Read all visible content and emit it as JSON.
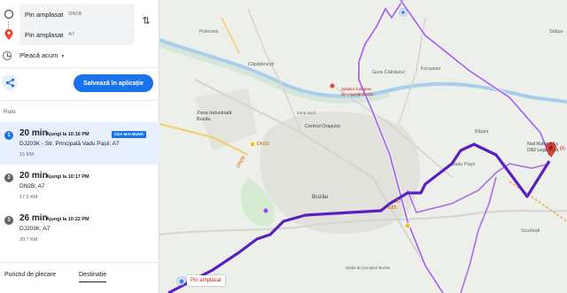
{
  "waypoints": [
    {
      "main": "Pin amplasat",
      "sub": "DN1B"
    },
    {
      "main": "Pin amplasat",
      "sub": "A7"
    }
  ],
  "depart": {
    "label": "Pleacă acum"
  },
  "save_button": {
    "label": "Salvează în aplicație"
  },
  "routes": {
    "title": "Rute",
    "items": [
      {
        "index": "1",
        "time": "20 min",
        "arrive": "Ajungi la 10:16 PM",
        "badge": "CEA MAI BUNĂ",
        "via": "DJ203K - Str. Principală Vadu Pașii; A7",
        "distance": "15 KM"
      },
      {
        "index": "2",
        "time": "20 min",
        "arrive": "Ajungi la 10:17 PM",
        "via": "DN2B; A7",
        "distance": "17.2 KM"
      },
      {
        "index": "3",
        "time": "26 min",
        "arrive": "Ajungi la 10:22 PM",
        "via": "DJ203K; A7",
        "distance": "20.7 KM"
      }
    ]
  },
  "tabs": {
    "start": "Punctul de plecare",
    "destination": "Destinație"
  },
  "map": {
    "pin_label": "Pin amplasat",
    "dest_pin_text": "Pi",
    "places": {
      "potoceni": "Potoceni",
      "capatanesti": "Căpățânești",
      "gura_calnaului": "Gura Călnăului",
      "focsanei": "Focșanei",
      "stalpu": "Stâlpu",
      "zona_industriala": "Zona Industrială Buzău",
      "centrul_orasului": "Centrul Orașului",
      "buzau": "Buzău",
      "vadu_pasii": "Vadu Pașii",
      "bajani": "Bâjani",
      "scurtesti": "Scurtești",
      "nod_rutier": "Nod Rutier A7 x DN2 Lega Buză",
      "spitalul": "Spitalul Județean de Urgență Buzău",
      "fire_station": "Stația de pompieri Buzău",
      "zone_nord": "Zona Nord",
      "dn2b": "DN2B",
      "dn10": "DN10",
      "e85": "E85",
      "a7": "A7"
    }
  },
  "colors": {
    "accent": "#1a73e8",
    "route_selected": "#5a1fc0",
    "route_alt": "#a970e8",
    "pin": "#ea4335"
  }
}
